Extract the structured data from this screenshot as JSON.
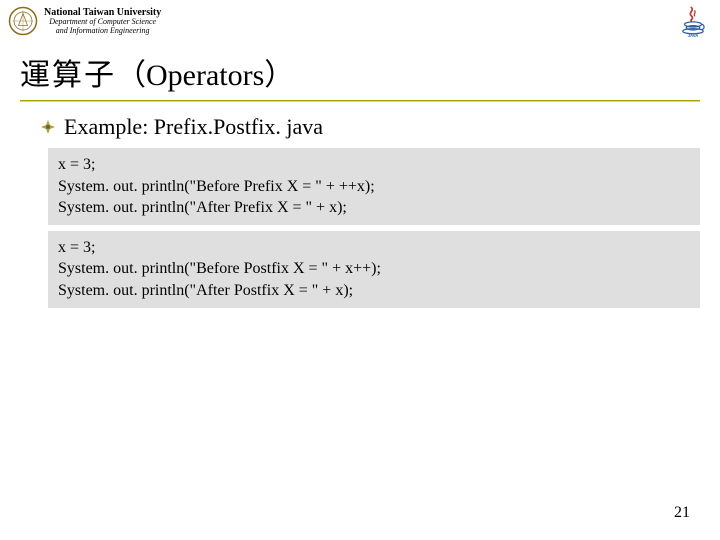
{
  "header": {
    "uni_title": "National Taiwan University",
    "dept_line1": "Department of Computer Science",
    "dept_line2": "and Information Engineering"
  },
  "title_cjk": "運算子",
  "title_ops": "（Operators）",
  "subtitle": "Example: Prefix.Postfix. java",
  "code_block_1": "x = 3;\nSystem. out. println(\"Before Prefix X = \" + ++x);\nSystem. out. println(\"After Prefix X = \" + x);",
  "code_block_2": "x = 3;\nSystem. out. println(\"Before Postfix X = \" + x++);\nSystem. out. println(\"After Postfix X = \" + x);",
  "page_number": "21"
}
